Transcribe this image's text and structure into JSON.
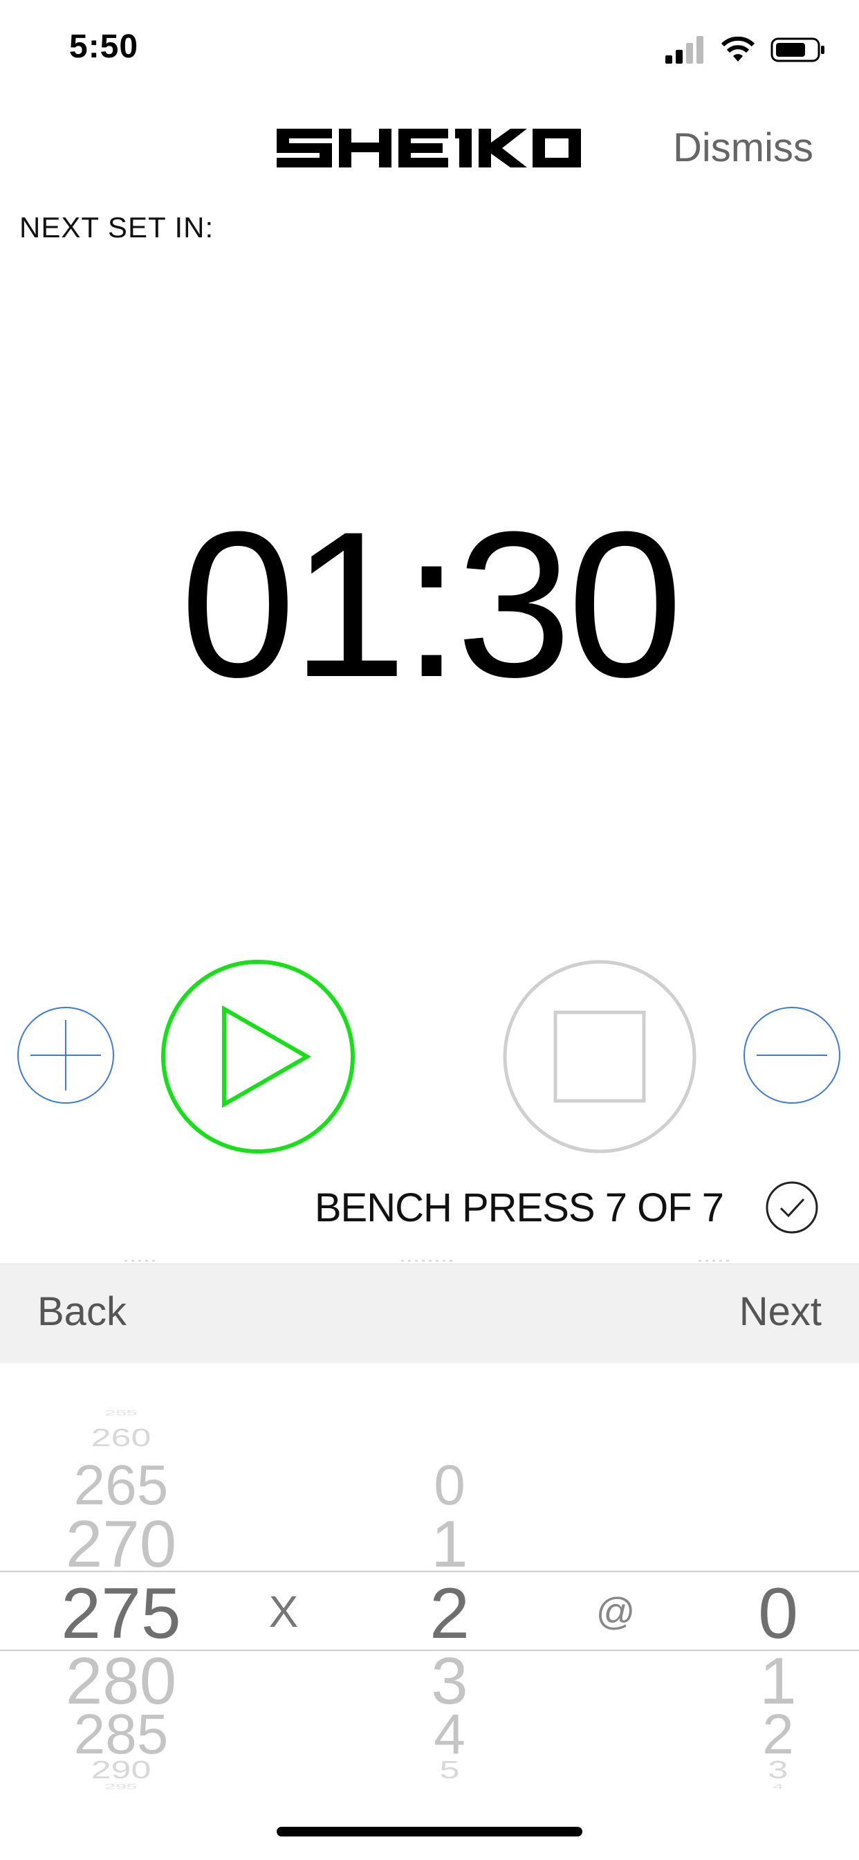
{
  "status_bar": {
    "time": "5:50"
  },
  "header": {
    "logo_text": "SHEIKO",
    "dismiss_label": "Dismiss"
  },
  "timer": {
    "caption": "NEXT SET IN:",
    "value": "01:30"
  },
  "controls": {
    "increment_icon": "plus-icon",
    "play_icon": "play-icon",
    "stop_icon": "stop-icon",
    "decrement_icon": "minus-icon"
  },
  "colors": {
    "accent_blue": "#3b7be0",
    "play_green": "#18e018",
    "stop_gray": "#cfcfcf"
  },
  "exercise": {
    "label": "BENCH PRESS 7 OF 7"
  },
  "toolbar": {
    "back_label": "Back",
    "next_label": "Next"
  },
  "picker": {
    "weight": [
      "255",
      "260",
      "265",
      "270",
      "275",
      "280",
      "285",
      "290",
      "295"
    ],
    "weight_selected": "275",
    "times_label": "X",
    "reps": [
      "0",
      "1",
      "2",
      "3",
      "4",
      "5"
    ],
    "reps_selected": "2",
    "at_label": "@",
    "rpe": [
      "0",
      "1",
      "2",
      "3",
      "4"
    ],
    "rpe_selected": "0"
  }
}
